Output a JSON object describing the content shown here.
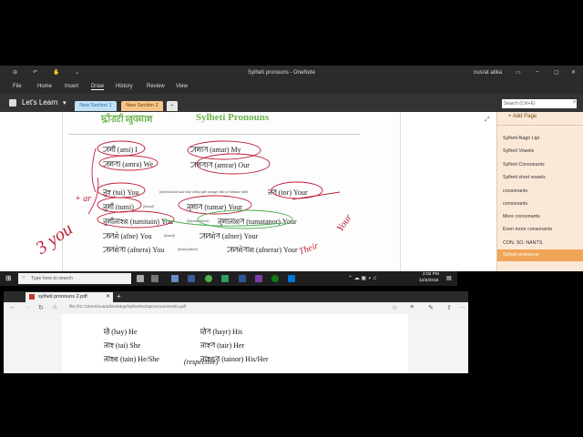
{
  "onenote": {
    "title": "Sylheti pronouns  -  OneNote",
    "user": "nusrat atika",
    "menu": [
      "File",
      "Home",
      "Insert",
      "Draw",
      "History",
      "Review",
      "View"
    ],
    "active_menu": "Draw",
    "notebook": "Let's Learn",
    "sections": [
      "New Section 1",
      "New Section 2",
      "+"
    ],
    "search_placeholder": "Search (Ctrl+E)",
    "add_page": "+ Add Page",
    "pages": [
      "Sylheti-Nagri Lipi",
      "Sylheti Vowels",
      "Sylheti Consonants",
      "Sylheti short vowels",
      "consonants",
      "consonants",
      "More consonants",
      "Even more consonants",
      "CON. SO. NANTS.",
      "Sylheti pronouns"
    ],
    "selected_page": "Sylheti pronouns",
    "heading_nagri": "ꠍꠤꠟꠐꠤ ꠢꠥꠛꠘꠣꠝ",
    "heading": "Sylheti Pronouns",
    "rows": [
      {
        "a": "ꠀꠝꠤ (ami) I",
        "an": "",
        "b": "ꠀꠝꠣꠞ (amar) My",
        "bn": ""
      },
      {
        "a": "ꠀꠝꠞꠣ (amra) We",
        "an": "",
        "b": "ꠀꠝꠞꠣꠞ (amrar) Our",
        "bn": ""
      },
      {
        "a": "ꠔꠥꠁ (tui) You",
        "an": "(informal and used only with people younger than or intimate with)",
        "b": "ꠔꠞ (tor) Your",
        "bn": ""
      },
      {
        "a": "ꠔꠥꠝꠤ (tumi)",
        "an": "(formal)",
        "b": "ꠔꠥꠝꠣꠞ  (tumar) Your",
        "bn": ""
      },
      {
        "a": "ꠔꠥꠝꠤꠔꠣꠁꠘ (tumitain) You",
        "an": "(informal plural)",
        "b": "ꠔꠥꠝꠣꠔꠣꠘꠞ (tumatanor) Your",
        "bn": ""
      },
      {
        "a": "ꠀꠙꠘꠦ (afne) You",
        "an": "(formal)",
        "b": "ꠀꠙꠘꠦꠞ (afner) Your",
        "bn": ""
      },
      {
        "a": "ꠀꠙꠘꠦꠞꠣ (afnera) You",
        "an": "(formal plural)",
        "b": "ꠀꠙꠘꠦꠞꠣꠘ (afnerar) Your",
        "bn": ""
      }
    ],
    "annotations": [
      "3 you",
      "+ ar",
      "Their",
      "Your"
    ]
  },
  "taskbar": {
    "search_placeholder": "Type here to search",
    "time": "2:02 PM",
    "date": "12/2/2018"
  },
  "edge": {
    "tab_title": "sylheti pronouns 2.pdf",
    "address": "file:///C:/Users/nusra/Desktop/Sylheti%20pronouns%202.pdf",
    "rows": [
      {
        "a": "ꠢꠦ (hay) He",
        "b": "ꠢꠦꠞ (hayr) His"
      },
      {
        "a": "ꠔꠣꠁ (tai) She",
        "b": "ꠔꠣꠁꠞ (tair) Her"
      },
      {
        "a": "ꠔꠣꠁꠘ (tain) He/She",
        "an": "(respective)",
        "b": "ꠔꠣꠁꠘꠞ (tainor) His/Her"
      }
    ]
  }
}
